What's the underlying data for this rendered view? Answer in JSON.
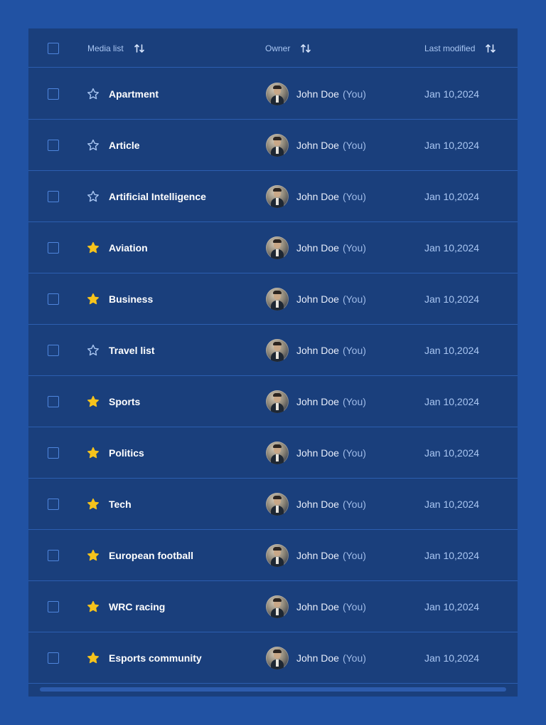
{
  "colors": {
    "page_bg": "#2152a3",
    "panel_bg": "#1a3f7c",
    "divider": "#2c5eb0",
    "accent": "#4f86dd",
    "star_filled": "#f6c31c",
    "star_outline": "#a9c6f2"
  },
  "header": {
    "media_list": "Media list",
    "owner": "Owner",
    "last_modified": "Last modified",
    "sort_icon": "sort-arrows-icon"
  },
  "rows": [
    {
      "name": "Apartment",
      "starred": false,
      "owner": "John Doe",
      "owner_tag": "(You)",
      "date": "Jan 10,2024"
    },
    {
      "name": "Article",
      "starred": false,
      "owner": "John Doe",
      "owner_tag": "(You)",
      "date": "Jan 10,2024"
    },
    {
      "name": "Artificial Intelligence",
      "starred": false,
      "owner": "John Doe",
      "owner_tag": "(You)",
      "date": "Jan 10,2024"
    },
    {
      "name": "Aviation",
      "starred": true,
      "owner": "John Doe",
      "owner_tag": "(You)",
      "date": "Jan 10,2024"
    },
    {
      "name": "Business",
      "starred": true,
      "owner": "John Doe",
      "owner_tag": "(You)",
      "date": "Jan 10,2024"
    },
    {
      "name": "Travel list",
      "starred": false,
      "owner": "John Doe",
      "owner_tag": "(You)",
      "date": "Jan 10,2024"
    },
    {
      "name": "Sports",
      "starred": true,
      "owner": "John Doe",
      "owner_tag": "(You)",
      "date": "Jan 10,2024"
    },
    {
      "name": "Politics",
      "starred": true,
      "owner": "John Doe",
      "owner_tag": "(You)",
      "date": "Jan 10,2024"
    },
    {
      "name": "Tech",
      "starred": true,
      "owner": "John Doe",
      "owner_tag": "(You)",
      "date": "Jan 10,2024"
    },
    {
      "name": "European football",
      "starred": true,
      "owner": "John Doe",
      "owner_tag": "(You)",
      "date": "Jan 10,2024"
    },
    {
      "name": "WRC racing",
      "starred": true,
      "owner": "John Doe",
      "owner_tag": "(You)",
      "date": "Jan 10,2024"
    },
    {
      "name": "Esports community",
      "starred": true,
      "owner": "John Doe",
      "owner_tag": "(You)",
      "date": "Jan 10,2024"
    }
  ]
}
